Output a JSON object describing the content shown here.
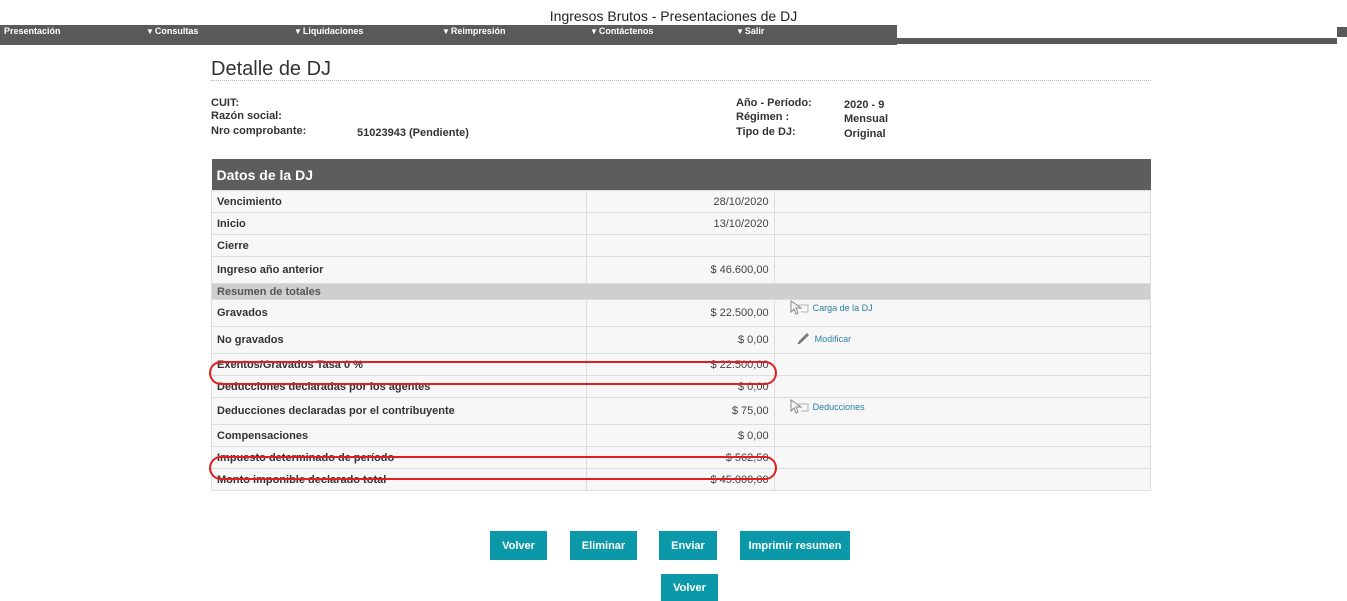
{
  "app": {
    "title": "Ingresos Brutos - Presentaciones de DJ"
  },
  "nav": [
    {
      "label": "Presentación",
      "arrow": false
    },
    {
      "label": "Consultas",
      "arrow": true
    },
    {
      "label": "Liquidaciones",
      "arrow": true
    },
    {
      "label": "Reimpresión",
      "arrow": true
    },
    {
      "label": "Contáctenos",
      "arrow": true
    },
    {
      "label": "Salir",
      "arrow": true
    }
  ],
  "page": {
    "title": "Detalle de DJ"
  },
  "info": {
    "cuit_label": "CUIT:",
    "razon_label": "Razón social:",
    "nro_label": "Nro comprobante:",
    "nro_value": "51023943 (Pendiente)",
    "periodo_label": "Año - Período:",
    "periodo_value": "2020 - 9",
    "regimen_label": "Régimen :",
    "regimen_value": "Mensual",
    "tipo_label": "Tipo de DJ:",
    "tipo_value": "Original"
  },
  "table": {
    "header": "Datos de la DJ",
    "rows": [
      {
        "label": "Vencimiento",
        "value": "28/10/2020"
      },
      {
        "label": "Inicio",
        "value": "13/10/2020"
      },
      {
        "label": "Cierre",
        "value": ""
      },
      {
        "label": "Ingreso año anterior",
        "value": "$ 46.600,00"
      }
    ],
    "section": "Resumen de totales",
    "totals": [
      {
        "label": "Gravados",
        "value": "$ 22.500,00",
        "action": "Carga de la DJ",
        "icon": "cursor-icon"
      },
      {
        "label": "No gravados",
        "value": "$ 0,00",
        "action": "Modificar",
        "icon": "pencil-icon"
      },
      {
        "label": "Exentos/Gravados Tasa 0 %",
        "value": "$ 22.500,00",
        "action": ""
      },
      {
        "label": "Deducciones declaradas por los agentes",
        "value": "$ 0,00",
        "action": ""
      },
      {
        "label": "Deducciones declaradas por el contribuyente",
        "value": "$ 75,00",
        "action": "Deducciones",
        "icon": "cursor-icon"
      },
      {
        "label": "Compensaciones",
        "value": "$ 0,00",
        "action": ""
      },
      {
        "label": "Impuesto determinado de período",
        "value": "$ 562,50",
        "action": ""
      },
      {
        "label": "Monto imponible declarado total",
        "value": "$ 45.000,00",
        "action": ""
      }
    ]
  },
  "buttons": {
    "volver": "Volver",
    "eliminar": "Eliminar",
    "enviar": "Enviar",
    "imprimir": "Imprimir resumen",
    "volver2": "Volver"
  },
  "colors": {
    "nav_bg": "#5a5a5a",
    "button_bg": "#0b98a8",
    "highlight": "#e02020",
    "link": "#2a7fa3"
  }
}
